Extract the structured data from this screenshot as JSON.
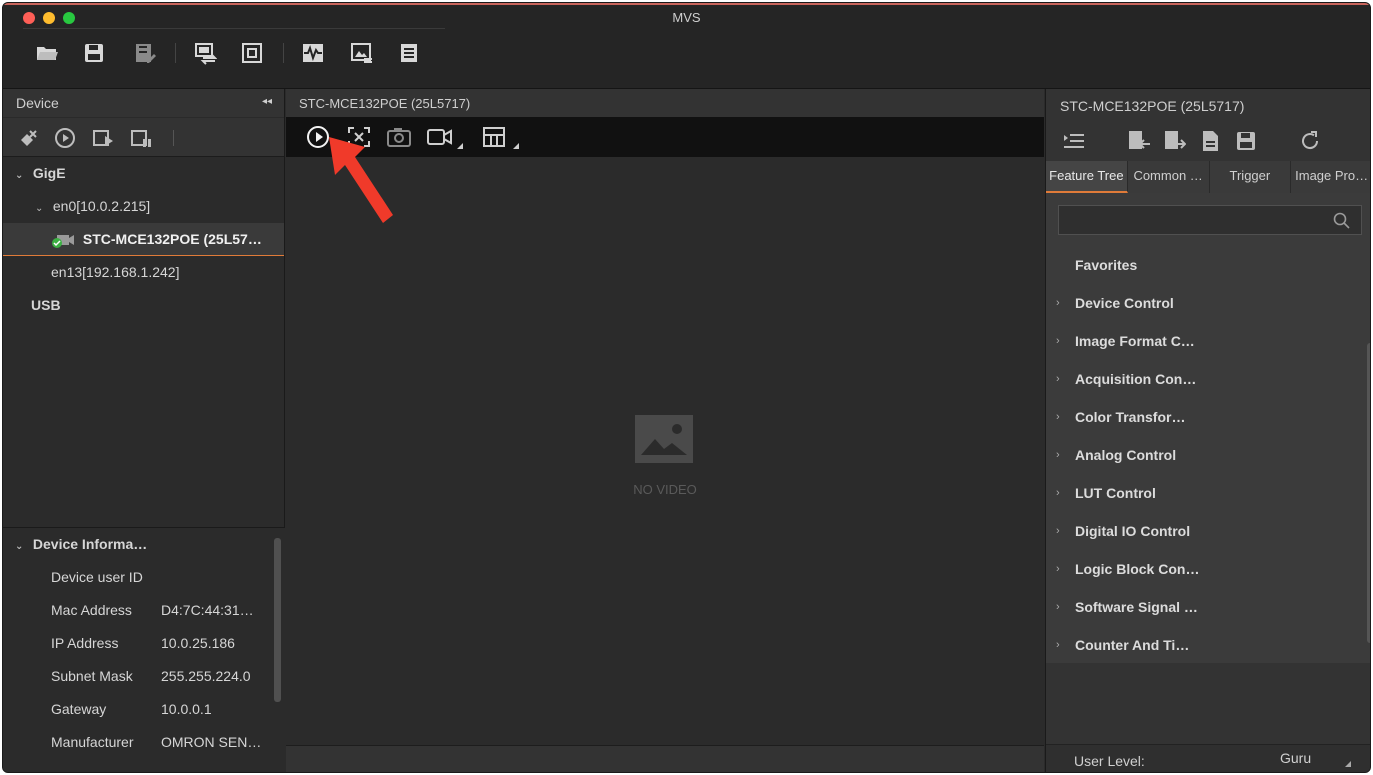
{
  "window": {
    "title": "MVS"
  },
  "toolbar": {
    "icons": [
      "folder-open-icon",
      "save-icon",
      "save-as-icon",
      "switch-window-icon",
      "fit-window-icon",
      "performance-icon",
      "image-chart-icon",
      "log-icon"
    ]
  },
  "device_panel": {
    "title": "Device",
    "tree": {
      "gige_label": "GigE",
      "en0_label": "en0[10.0.2.215]",
      "camera_label": "STC-MCE132POE (25L57…",
      "en13_label": "en13[192.168.1.242]",
      "usb_label": "USB"
    }
  },
  "device_info": {
    "title": "Device Informa…",
    "rows": [
      {
        "key": "Device user ID",
        "value": ""
      },
      {
        "key": "Mac Address",
        "value": "D4:7C:44:31…"
      },
      {
        "key": "IP Address",
        "value": "10.0.25.186"
      },
      {
        "key": "Subnet Mask",
        "value": "255.255.224.0"
      },
      {
        "key": "Gateway",
        "value": "10.0.0.1"
      },
      {
        "key": "Manufacturer",
        "value": "OMRON SEN…"
      }
    ]
  },
  "preview": {
    "title": "STC-MCE132POE (25L5717)",
    "no_video": "NO VIDEO"
  },
  "properties": {
    "title": "STC-MCE132POE (25L5717)",
    "tabs": [
      "Feature Tree",
      "Common …",
      "Trigger",
      "Image Pro…"
    ],
    "favorites": "Favorites",
    "features": [
      "Device Control",
      "Image Format C…",
      "Acquisition Con…",
      "Color Transfor…",
      "Analog Control",
      "LUT Control",
      "Digital IO Control",
      "Logic Block Con…",
      "Software Signal …",
      "Counter And Ti…"
    ],
    "user_level_label": "User Level:",
    "user_level_value": "Guru"
  },
  "colors": {
    "accent": "#e07b39",
    "arrow": "#f03a2a",
    "bg": "#2b2b2b"
  }
}
